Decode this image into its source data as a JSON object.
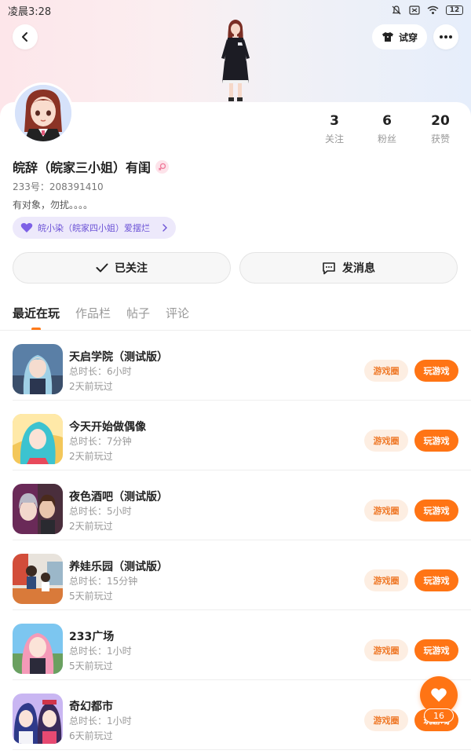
{
  "status_bar": {
    "time": "凌晨3:28",
    "battery": "12"
  },
  "header": {
    "try_on_label": "试穿"
  },
  "profile": {
    "name": "皖辞（皖家三小姐）有闺",
    "uid": "233号：208391410",
    "bio": "有对象，勿扰。。。。",
    "relation_tag": "皖小染（皖家四小姐）爱摆烂",
    "stats": [
      {
        "value": "3",
        "label": "关注"
      },
      {
        "value": "6",
        "label": "粉丝"
      },
      {
        "value": "20",
        "label": "获赞"
      }
    ]
  },
  "actions": {
    "follow_label": "已关注",
    "message_label": "发消息"
  },
  "tabs": [
    {
      "label": "最近在玩",
      "active": true
    },
    {
      "label": "作品栏",
      "active": false
    },
    {
      "label": "帖子",
      "active": false
    },
    {
      "label": "评论",
      "active": false
    }
  ],
  "games": [
    {
      "title": "天启学院（测试版）",
      "duration": "总时长：6小时",
      "last_played": "2天前玩过",
      "circle_label": "游戏圈",
      "play_label": "玩游戏"
    },
    {
      "title": "今天开始做偶像",
      "duration": "总时长：7分钟",
      "last_played": "2天前玩过",
      "circle_label": "游戏圈",
      "play_label": "玩游戏"
    },
    {
      "title": "夜色酒吧（测试版）",
      "duration": "总时长：5小时",
      "last_played": "2天前玩过",
      "circle_label": "游戏圈",
      "play_label": "玩游戏"
    },
    {
      "title": "养娃乐园（测试版）",
      "duration": "总时长：15分钟",
      "last_played": "5天前玩过",
      "circle_label": "游戏圈",
      "play_label": "玩游戏"
    },
    {
      "title": "233广场",
      "duration": "总时长：1小时",
      "last_played": "5天前玩过",
      "circle_label": "游戏圈",
      "play_label": "玩游戏"
    },
    {
      "title": "奇幻都市",
      "duration": "总时长：1小时",
      "last_played": "6天前玩过",
      "circle_label": "游戏圈",
      "play_label": "玩游戏"
    }
  ],
  "like_fab": {
    "count": "16"
  },
  "colors": {
    "accent": "#ff7414",
    "accent_light": "#fdeee2",
    "tag_purple": "#6c53d6"
  },
  "icons": {
    "back": "chevron-left-icon",
    "more": "more-dots-icon",
    "try_on": "tshirt-icon",
    "follow": "check-icon",
    "message": "chat-bubble-icon",
    "gender": "female-icon",
    "relation": "heart-icon",
    "like": "heart-icon"
  }
}
